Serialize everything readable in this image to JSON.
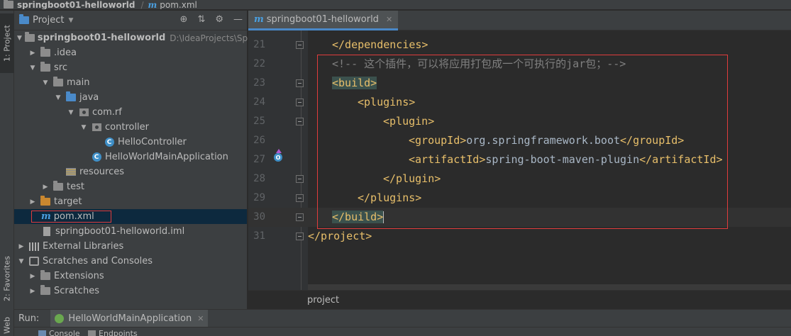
{
  "breadcrumb": {
    "project": "springboot01-helloworld",
    "file": "pom.xml"
  },
  "sidebar": {
    "project_tab": "1: Project",
    "favorites_tab": "2: Favorites",
    "web_tab": "Web"
  },
  "project_panel": {
    "title": "Project",
    "tree": {
      "root": "springboot01-helloworld",
      "root_path": "D:\\IdeaProjects\\Spring",
      "idea": ".idea",
      "src": "src",
      "main": "main",
      "java": "java",
      "pkg": "com.rf",
      "controller": "controller",
      "hello_controller": "HelloController",
      "main_app": "HelloWorldMainApplication",
      "resources": "resources",
      "test": "test",
      "target": "target",
      "pom": "pom.xml",
      "iml": "springboot01-helloworld.iml",
      "external_libs": "External Libraries",
      "scratches_consoles": "Scratches and Consoles",
      "extensions": "Extensions",
      "scratches": "Scratches"
    }
  },
  "editor": {
    "tab_label": "springboot01-helloworld",
    "breadcrumb": "project",
    "lines": {
      "n21": "21",
      "n22": "22",
      "n23": "23",
      "n24": "24",
      "n25": "25",
      "n26": "26",
      "n27": "27",
      "n28": "28",
      "n29": "29",
      "n30": "30",
      "n31": "31",
      "l21": "</dependencies>",
      "l22": "<!-- 这个插件，可以将应用打包成一个可执行的jar包；-->",
      "l23": "<build>",
      "l24": "<plugins>",
      "l25": "<plugin>",
      "l26_open": "<groupId>",
      "l26_text": "org.springframework.boot",
      "l26_close": "</groupId>",
      "l27_open": "<artifactId>",
      "l27_text": "spring-boot-maven-plugin",
      "l27_close": "</artifactId>",
      "l28": "</plugin>",
      "l29": "</plugins>",
      "l30": "</build>",
      "l31": "</project>"
    }
  },
  "run_bar": {
    "label": "Run:",
    "config": "HelloWorldMainApplication",
    "console": "Console",
    "endpoints": "Endpoints"
  }
}
